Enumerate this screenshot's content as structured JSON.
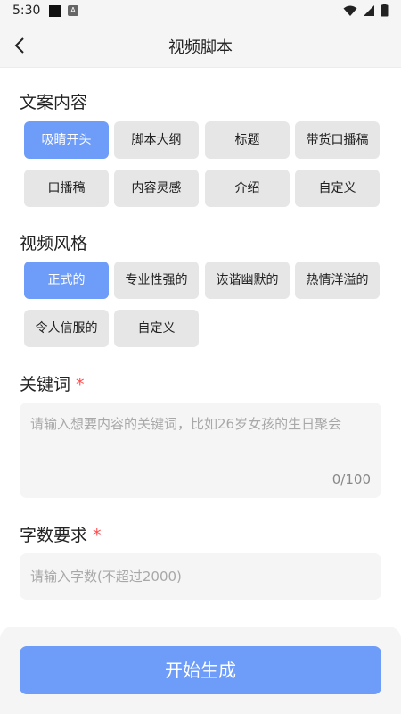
{
  "status": {
    "time": "5:30",
    "a_icon_label": "A"
  },
  "header": {
    "title": "视频脚本"
  },
  "copy_section": {
    "title": "文案内容",
    "options": [
      "吸睛开头",
      "脚本大纲",
      "标题",
      "带货口播稿",
      "口播稿",
      "内容灵感",
      "介绍",
      "自定义"
    ],
    "selected": "吸睛开头"
  },
  "style_section": {
    "title": "视频风格",
    "options": [
      "正式的",
      "专业性强的",
      "诙谐幽默的",
      "热情洋溢的",
      "令人信服的",
      "自定义"
    ],
    "selected": "正式的"
  },
  "keywords": {
    "label": "关键词",
    "required_mark": "*",
    "placeholder": "请输入想要内容的关键词，比如26岁女孩的生日聚会",
    "counter": "0/100"
  },
  "word_count": {
    "label": "字数要求",
    "required_mark": "*",
    "placeholder": "请输入字数(不超过2000)"
  },
  "generate_button": "开始生成",
  "colors": {
    "accent": "#6e9cf9",
    "required": "#ff4d4f",
    "chip": "#e6e6e6"
  }
}
